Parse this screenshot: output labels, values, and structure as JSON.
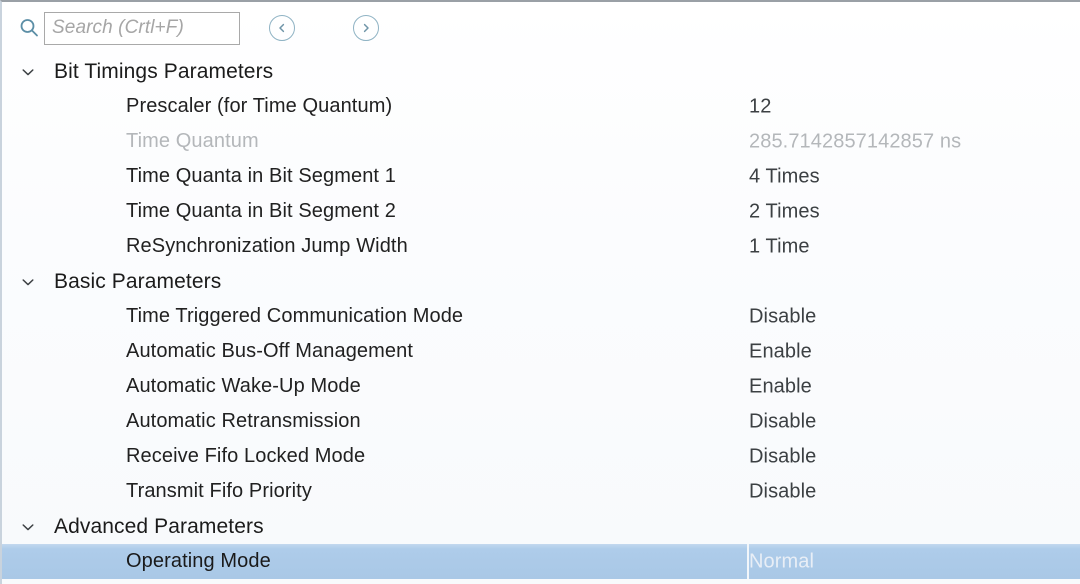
{
  "search": {
    "placeholder": "Search (Crtl+F)",
    "value": "",
    "icon": "search-icon",
    "prev_icon": "chevron-left-circle-icon",
    "next_icon": "chevron-right-circle-icon"
  },
  "colors": {
    "selection": "#aeccea",
    "icon_accent": "#8fb3c4",
    "text": "#212121",
    "muted_text": "#b4b7ba"
  },
  "groups": [
    {
      "title": "Bit Timings Parameters",
      "expanded": true,
      "chevron_icon": "chevron-down-icon",
      "rows": [
        {
          "label": "Prescaler (for Time Quantum)",
          "value": "12",
          "disabled": false,
          "selected": false
        },
        {
          "label": "Time Quantum",
          "value": "285.7142857142857 ns",
          "disabled": true,
          "selected": false
        },
        {
          "label": "Time Quanta in Bit Segment 1",
          "value": "4 Times",
          "disabled": false,
          "selected": false
        },
        {
          "label": "Time Quanta in Bit Segment 2",
          "value": "2 Times",
          "disabled": false,
          "selected": false
        },
        {
          "label": "ReSynchronization Jump Width",
          "value": "1 Time",
          "disabled": false,
          "selected": false
        }
      ]
    },
    {
      "title": "Basic Parameters",
      "expanded": true,
      "chevron_icon": "chevron-down-icon",
      "rows": [
        {
          "label": "Time Triggered Communication Mode",
          "value": "Disable",
          "disabled": false,
          "selected": false
        },
        {
          "label": "Automatic Bus-Off Management",
          "value": "Enable",
          "disabled": false,
          "selected": false
        },
        {
          "label": "Automatic Wake-Up Mode",
          "value": "Enable",
          "disabled": false,
          "selected": false
        },
        {
          "label": "Automatic Retransmission",
          "value": "Disable",
          "disabled": false,
          "selected": false
        },
        {
          "label": "Receive Fifo Locked Mode",
          "value": "Disable",
          "disabled": false,
          "selected": false
        },
        {
          "label": "Transmit Fifo Priority",
          "value": "Disable",
          "disabled": false,
          "selected": false
        }
      ]
    },
    {
      "title": "Advanced Parameters",
      "expanded": true,
      "chevron_icon": "chevron-down-icon",
      "rows": [
        {
          "label": "Operating Mode",
          "value": "Normal",
          "disabled": false,
          "selected": true
        }
      ]
    }
  ]
}
